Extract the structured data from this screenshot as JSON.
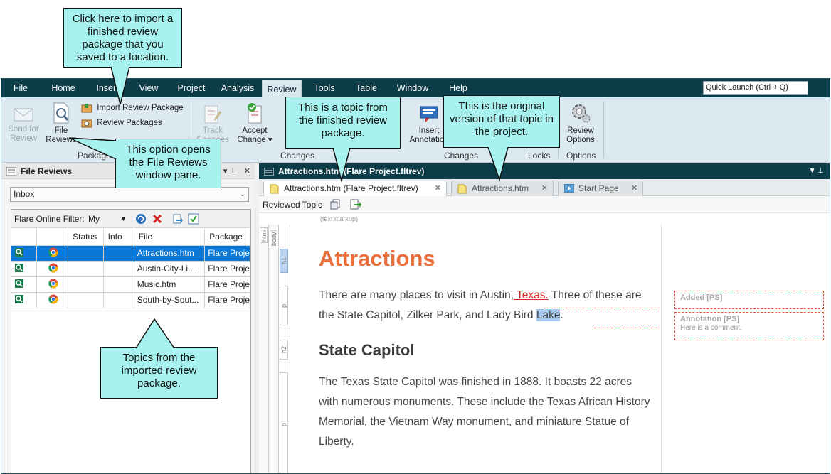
{
  "app": {
    "menu": [
      "File",
      "Home",
      "Insert",
      "View",
      "Project",
      "Analysis",
      "Review",
      "Tools",
      "Table",
      "Window",
      "Help"
    ],
    "active_menu": "Review",
    "quick_launch_placeholder": "Quick Launch (Ctrl + Q)"
  },
  "ribbon": {
    "send_for_review": "Send for Review",
    "file_reviews": "File Reviews",
    "import_review_package": "Import Review Package",
    "review_packages": "Review Packages",
    "group_packages": "Packages",
    "track_changes": "Track Changes",
    "accept_change": "Accept Change ▾",
    "group_changes": "Changes",
    "insert_annotation": "Insert Annotation",
    "group_changes2": "Changes",
    "group_locks": "Locks",
    "review_options": "Review Options",
    "group_options": "Options"
  },
  "left_pane": {
    "title": "File Reviews",
    "inbox": "Inbox",
    "filter_label": "Flare Online Filter:",
    "filter_value": "My",
    "columns": [
      "",
      "",
      "Status",
      "Info",
      "File",
      "Package"
    ],
    "rows": [
      {
        "file": "Attractions.htm",
        "package": "Flare Proje",
        "selected": true
      },
      {
        "file": "Austin-City-Li...",
        "package": "Flare Proje",
        "selected": false
      },
      {
        "file": "Music.htm",
        "package": "Flare Proje",
        "selected": false
      },
      {
        "file": "South-by-Sout...",
        "package": "Flare Proje",
        "selected": false
      }
    ]
  },
  "right_pane": {
    "title": "Attractions.htm (Flare Project.fltrev)",
    "tabs": [
      {
        "label": "Attractions.htm (Flare Project.fltrev)",
        "active": true
      },
      {
        "label": "Attractions.htm",
        "active": false
      },
      {
        "label": "Start Page",
        "active": false
      }
    ],
    "toolbar_label": "Reviewed Topic",
    "text_markup": "(text markup)",
    "struct_tags": {
      "html": "html",
      "body": "body",
      "h1": "h1",
      "p1": "p",
      "h2": "h2",
      "p2": "p"
    },
    "doc": {
      "h1": "Attractions",
      "p1_a": "There are many places to visit in Austin,",
      "p1_added": " Texas.",
      "p1_b": " Three of these are the State Capitol, Zilker Park, and Lady Bird ",
      "p1_hl": "Lake",
      "p1_c": ".",
      "h2": "State Capitol",
      "p2": "The Texas State Capitol was finished in 1888. It boasts 22 acres with numerous monuments. These include the Texas African History Memorial, the Vietnam Way monument, and miniature Statue of Liberty."
    },
    "comments": [
      {
        "title": "Added [PS]",
        "body": ""
      },
      {
        "title": "Annotation [PS]",
        "body": "Here is a comment."
      }
    ]
  },
  "callouts": {
    "import": "Click here to import a finished review package that you saved to a location.",
    "file_reviews": "This option opens the File Reviews window pane.",
    "topic": "This is a topic from the finished review package.",
    "original": "This is the original version of that topic in the project.",
    "topics": "Topics from the imported review package."
  },
  "colors": {
    "menubar": "#0e3d4a",
    "callout": "#a7f2ef",
    "heading": "#e86e3c",
    "selection": "#0a78d7",
    "added_text": "#d8292a"
  }
}
